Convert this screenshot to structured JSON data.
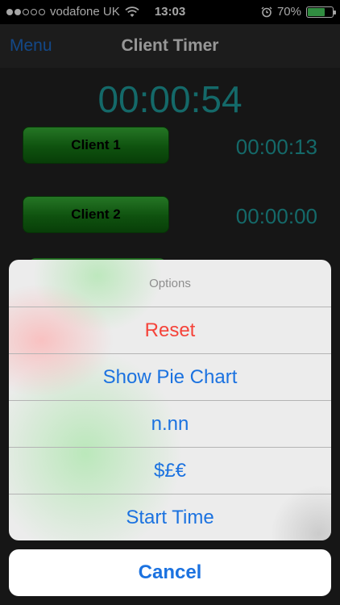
{
  "status_bar": {
    "signal_full": 2,
    "signal_empty": 3,
    "carrier": "vodafone UK",
    "wifi_icon": "wifi-icon",
    "time": "13:03",
    "alarm_icon": "alarm-clock-icon",
    "battery_percent": "70%",
    "battery_level": 0.7,
    "battery_color": "#4cd964"
  },
  "nav_bar": {
    "menu_label": "Menu",
    "title": "Client Timer"
  },
  "timer": {
    "total": "00:00:54",
    "color": "#1fa2a2"
  },
  "clients": [
    {
      "label": "Client 1",
      "time": "00:00:13"
    },
    {
      "label": "Client 2",
      "time": "00:00:00"
    }
  ],
  "action_sheet": {
    "title": "Options",
    "items": [
      {
        "label": "Reset",
        "style": "destructive"
      },
      {
        "label": "Show Pie Chart",
        "style": "default"
      },
      {
        "label": "n.nn",
        "style": "default"
      },
      {
        "label": "$£€",
        "style": "default"
      },
      {
        "label": "Start Time",
        "style": "default"
      }
    ],
    "cancel_label": "Cancel",
    "accent": "#1b72e0",
    "destructive_color": "#f5433a"
  }
}
